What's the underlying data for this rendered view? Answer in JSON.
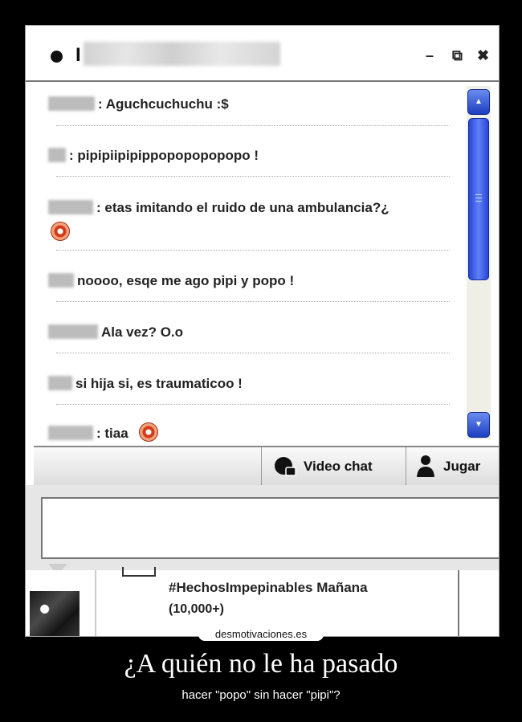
{
  "window": {
    "contact_initial": "I",
    "controls": {
      "minimize": "–",
      "restore": "⧉",
      "close": "✖"
    }
  },
  "messages": [
    {
      "text": ": Aguchcuchuchu :$"
    },
    {
      "text": ": pipipiipipippopopopopopo !"
    },
    {
      "text": ": etas imitando el ruido de una ambulancia?¿"
    },
    {
      "text": "noooo, esqe me ago pipi y popo !"
    },
    {
      "text": "Ala vez? O.o"
    },
    {
      "text": "si hija si, es traumaticoo !"
    },
    {
      "text": ": tiaa"
    }
  ],
  "toolbar": {
    "video_chat_label": "Video chat",
    "jugar_label": "Jugar"
  },
  "feed": {
    "trend_title": "#HechosImpepinables Mañana",
    "trend_count": "(10,000+)"
  },
  "watermark": "desmotivaciones.es",
  "caption": {
    "title": "¿A quién no le ha pasado",
    "subtitle": "hacer \"popo\" sin hacer \"pipi\"?"
  },
  "icons": {
    "status": "status-dot-icon",
    "emoticon": "red-emoticon-icon",
    "video": "video-chat-icon",
    "game": "game-person-icon"
  },
  "colors": {
    "scrollbar_blue": "#2846d8",
    "emoticon_red": "#d23a1a",
    "background": "#000000"
  }
}
